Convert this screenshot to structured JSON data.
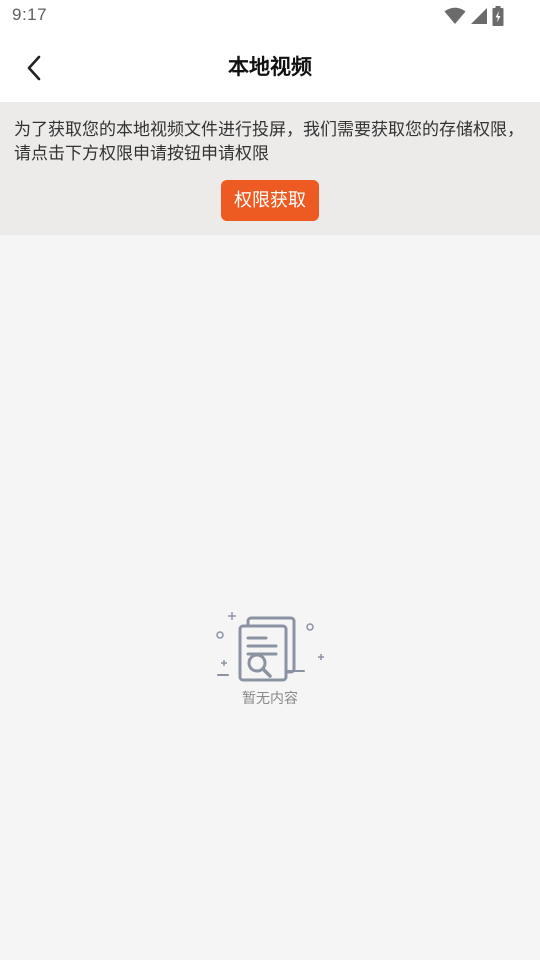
{
  "status_bar": {
    "time": "9:17"
  },
  "nav": {
    "title": "本地视频",
    "back_icon": "chevron-left-icon"
  },
  "permission": {
    "message": "为了获取您的本地视频文件进行投屏，我们需要获取您的存储权限，请点击下方权限申请按钮申请权限",
    "button_label": "权限获取",
    "button_color": "#ee5b22"
  },
  "empty": {
    "text": "暂无内容",
    "icon": "document-search-icon"
  }
}
